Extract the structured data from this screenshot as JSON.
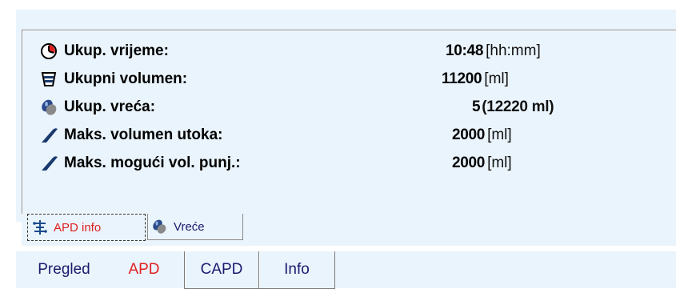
{
  "stats": [
    {
      "icon": "clock-icon",
      "label": "Ukup. vrijeme:",
      "value": "10:48",
      "unit": "[hh:mm]"
    },
    {
      "icon": "volume-cup-icon",
      "label": "Ukupni volumen:",
      "value": "11200",
      "unit": "[ml]"
    },
    {
      "icon": "bags-icon",
      "label": "Ukup. vreća:",
      "value": "5",
      "unit": "(12220 ml)"
    },
    {
      "icon": "inflow-tube-icon",
      "label": "Maks. volumen utoka:",
      "value": "2000",
      "unit": "[ml]"
    },
    {
      "icon": "inflow-tube-icon",
      "label": "Maks. mogući vol. punj.:",
      "value": "2000",
      "unit": "[ml]"
    }
  ],
  "subtabs": [
    {
      "label": "APD info",
      "icon": "apd-tree-icon",
      "active": true
    },
    {
      "label": "Vreće",
      "icon": "bags-icon",
      "active": false
    }
  ],
  "maintabs": [
    {
      "label": "Pregled",
      "active": false
    },
    {
      "label": "APD",
      "active": true
    },
    {
      "label": "CAPD",
      "active": false
    },
    {
      "label": "Info",
      "active": false
    }
  ],
  "colors": {
    "panel": "#eaf4fc",
    "active_tab_text": "#e02020",
    "tab_text": "#1a1a6e",
    "icon_blue": "#1a3a6e"
  }
}
